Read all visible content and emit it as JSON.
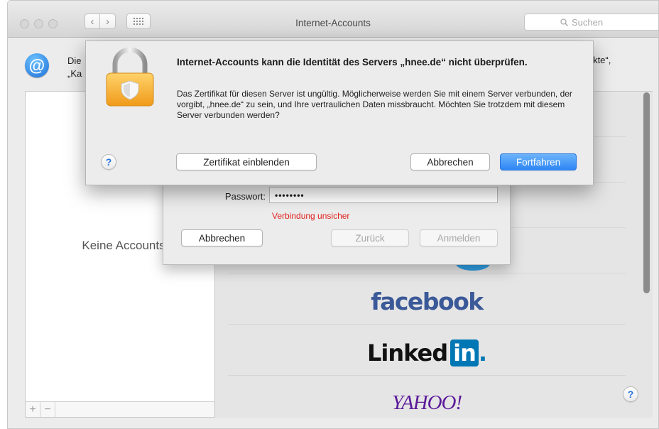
{
  "window": {
    "title": "Internet-Accounts",
    "search_placeholder": "Suchen",
    "nav_back": "‹",
    "nav_forward": "›"
  },
  "header": {
    "line1_start": "Die",
    "line2_start": "„Ka",
    "line1_end": "ntakte“,"
  },
  "left_list": {
    "empty_label": "Keine Accounts",
    "add_label": "+",
    "remove_label": "−"
  },
  "providers": {
    "facebook": "facebook",
    "linkedin_text": "Linked",
    "linkedin_box": "in",
    "linkedin_dot": ".",
    "yahoo": "YAHOO!"
  },
  "help_label": "?",
  "login_sheet": {
    "password_label": "Passwort:",
    "password_value": "••••••••",
    "warning": "Verbindung unsicher",
    "cancel": "Abbrechen",
    "back": "Zurück",
    "sign_in": "Anmelden"
  },
  "alert": {
    "title": "Internet-Accounts kann die Identität des Servers „hnee.de“ nicht überprüfen.",
    "body": "Das Zertifikat für diesen Server ist ungültig. Möglicherweise werden Sie mit einem Server verbunden, der vorgibt, „hnee.de“ zu sein, und Ihre vertraulichen Daten missbraucht. Möchten Sie trotzdem mit diesem Server verbunden werden?",
    "show_certificate": "Zertifikat einblenden",
    "cancel": "Abbrechen",
    "continue": "Fortfahren"
  },
  "colors": {
    "accent": "#2e86f5",
    "warning": "#e0211d",
    "facebook": "#3b5998",
    "linkedin": "#0077b5",
    "yahoo": "#5c1a9a"
  }
}
